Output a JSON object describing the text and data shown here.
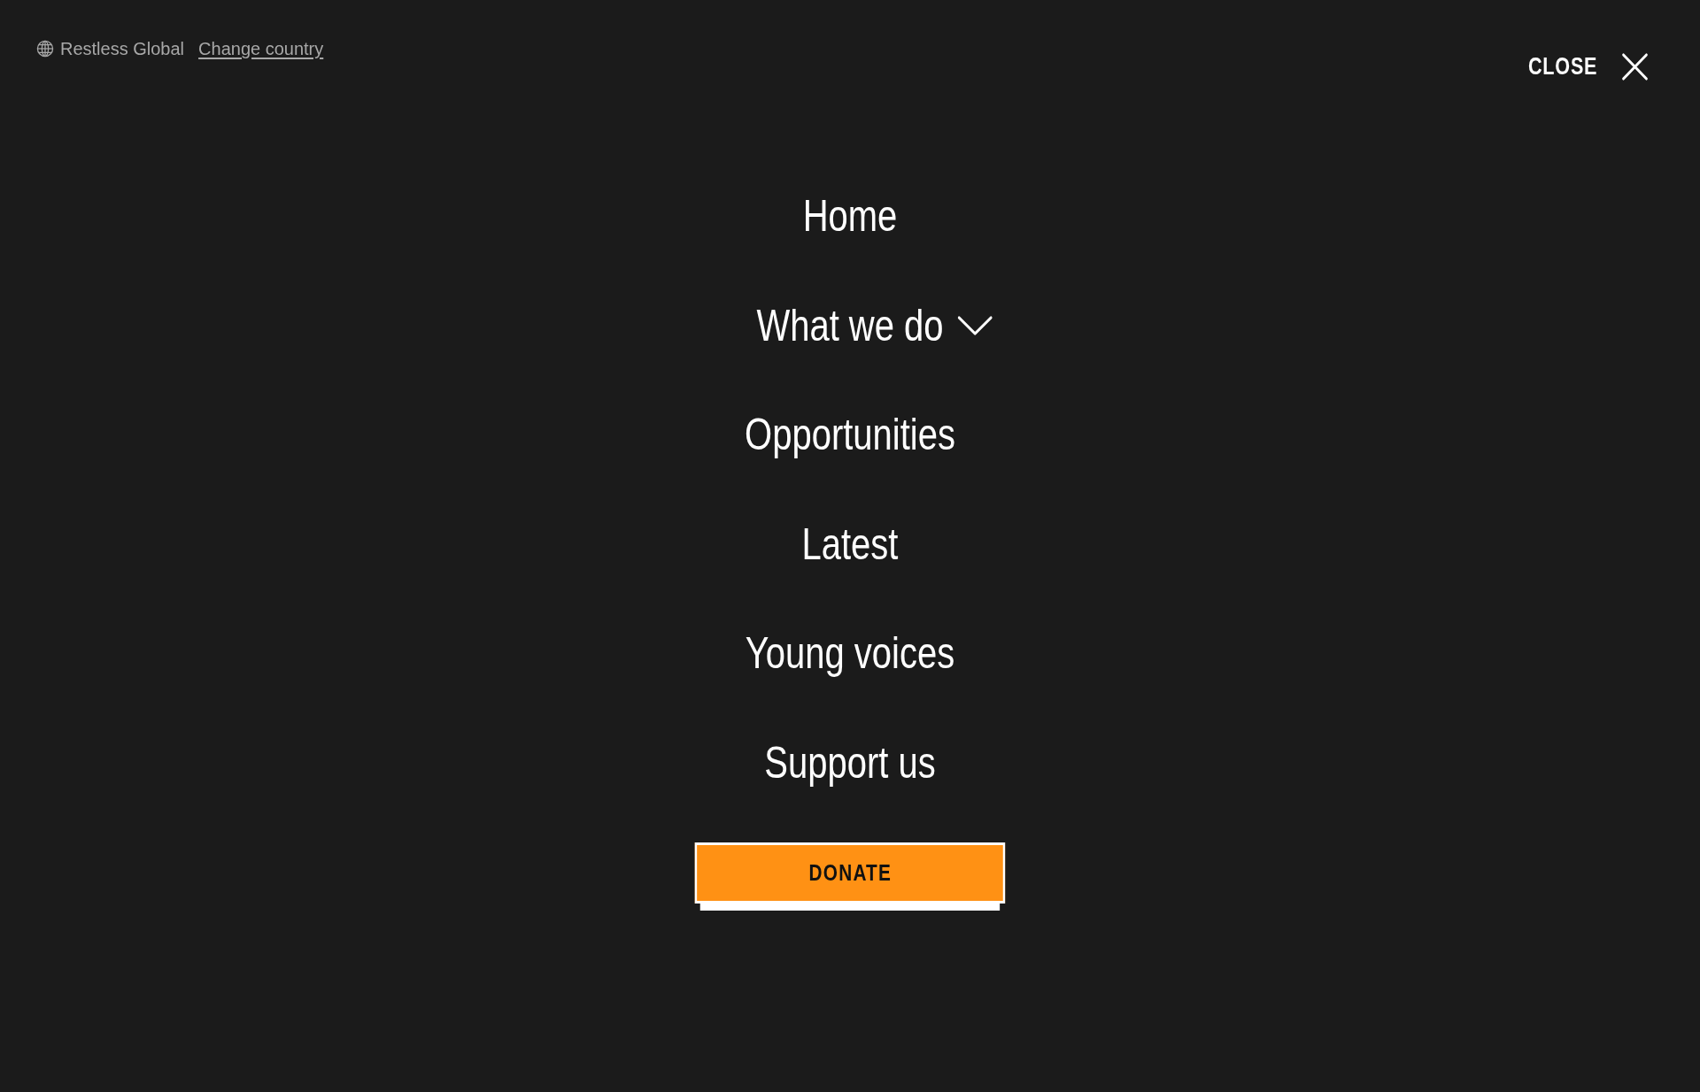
{
  "header": {
    "region": "Restless Global",
    "change_link": "Change country",
    "close_label": "CLOSE"
  },
  "menu": {
    "items": [
      {
        "label": "Home",
        "kind": "link"
      },
      {
        "label": "What we do",
        "kind": "submenu"
      },
      {
        "label": "Opportunities",
        "kind": "link"
      },
      {
        "label": "Latest",
        "kind": "link"
      },
      {
        "label": "Young voices",
        "kind": "link"
      },
      {
        "label": "Support us",
        "kind": "link"
      }
    ]
  },
  "donate_button": {
    "label": "DONATE"
  }
}
